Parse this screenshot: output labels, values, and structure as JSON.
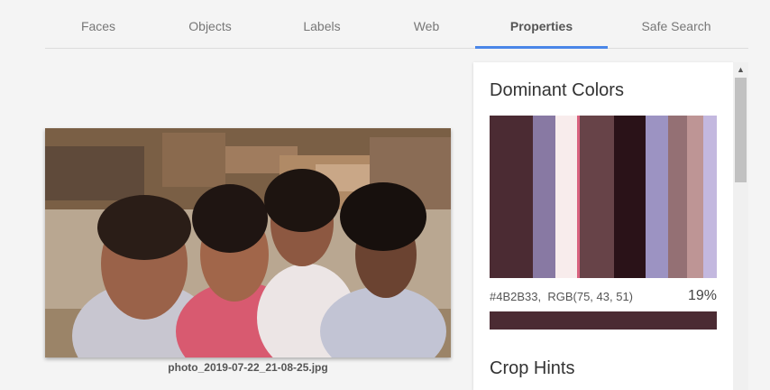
{
  "tabs": [
    {
      "label": "Faces"
    },
    {
      "label": "Objects"
    },
    {
      "label": "Labels"
    },
    {
      "label": "Web"
    },
    {
      "label": "Properties"
    },
    {
      "label": "Safe Search"
    }
  ],
  "photo": {
    "filename": "photo_2019-07-22_21-08-25.jpg"
  },
  "properties": {
    "dominant_title": "Dominant Colors",
    "colors": [
      "#4B2B33",
      "#8879A3",
      "#F8ECEC",
      "#D9627F",
      "#674348",
      "#2A1218",
      "#9C93C2",
      "#947074",
      "#BE9595",
      "#C3B8DF"
    ],
    "color_hex": "#4B2B33,",
    "color_rgb": "RGB(75, 43, 51)",
    "color_pct": "19%",
    "crop_title": "Crop Hints"
  },
  "accent": "#4a86e8"
}
